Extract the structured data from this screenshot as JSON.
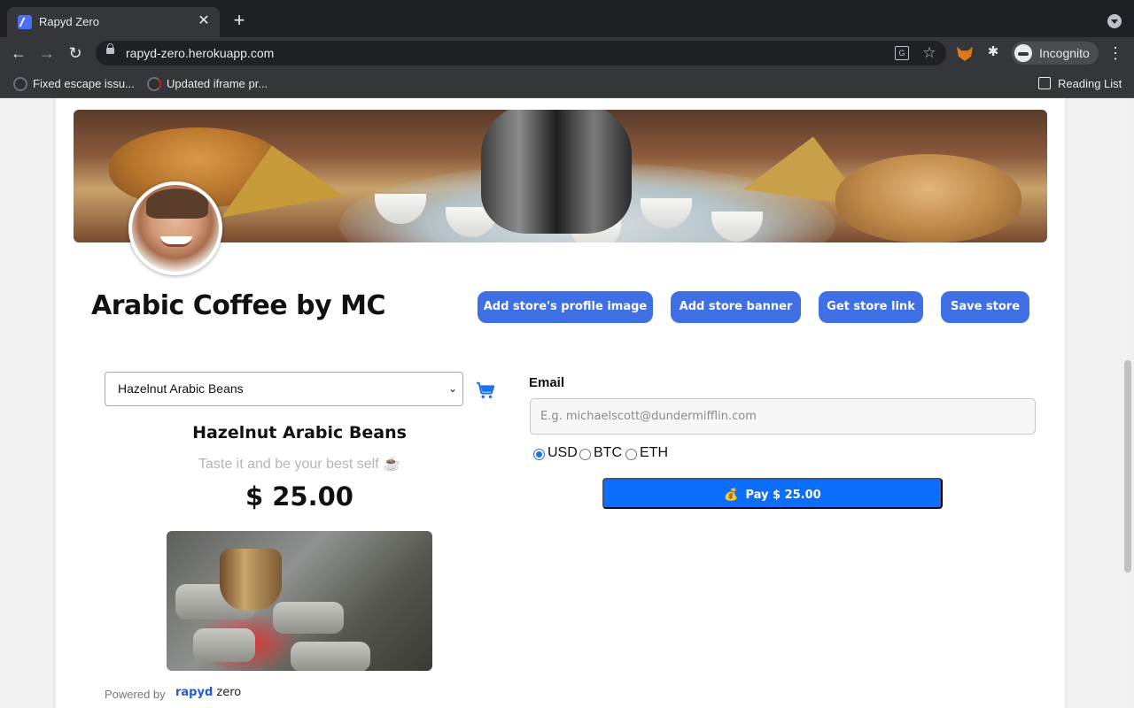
{
  "browser": {
    "tab_title": "Rapyd Zero",
    "tab_close": "✕",
    "new_tab": "+",
    "url": "rapyd-zero.herokuapp.com",
    "profile_label": "Incognito",
    "bookmarks": [
      {
        "label": "Fixed escape issu..."
      },
      {
        "label": "Updated iframe pr..."
      }
    ],
    "reading_list_label": "Reading List"
  },
  "store": {
    "name": "Arabic Coffee by MC",
    "actions": {
      "add_profile_image": "Add store's profile image",
      "add_banner": "Add store banner",
      "get_link": "Get store link",
      "save": "Save store"
    }
  },
  "product": {
    "selected_option": "Hazelnut Arabic Beans",
    "name": "Hazelnut Arabic Beans",
    "tagline": "Taste it and be your best self ☕",
    "price": "$ 25.00"
  },
  "payment": {
    "email_label": "Email",
    "email_placeholder": "E.g. michaelscott@dundermifflin.com",
    "email_value": "",
    "currencies": [
      {
        "label": "USD",
        "selected": true
      },
      {
        "label": "BTC",
        "selected": false
      },
      {
        "label": "ETH",
        "selected": false
      }
    ],
    "pay_label": "Pay $ 25.00",
    "pay_icon": "💰"
  },
  "footer": {
    "powered_by": "Powered by",
    "logo_brand": "rapyd",
    "logo_product": "zero"
  },
  "colors": {
    "primary_button": "#3f6fe4",
    "pay_button": "#0d6efd",
    "chrome_dark": "#202124"
  },
  "icons": {
    "back": "back-arrow-icon",
    "forward": "forward-arrow-icon",
    "reload": "reload-icon",
    "lock": "lock-icon",
    "translate": "translate-icon",
    "bookmark_star": "star-icon",
    "extension": "puzzle-icon",
    "metamask": "metamask-fox-icon",
    "menu": "kebab-menu-icon",
    "cart": "shopping-cart-icon"
  }
}
